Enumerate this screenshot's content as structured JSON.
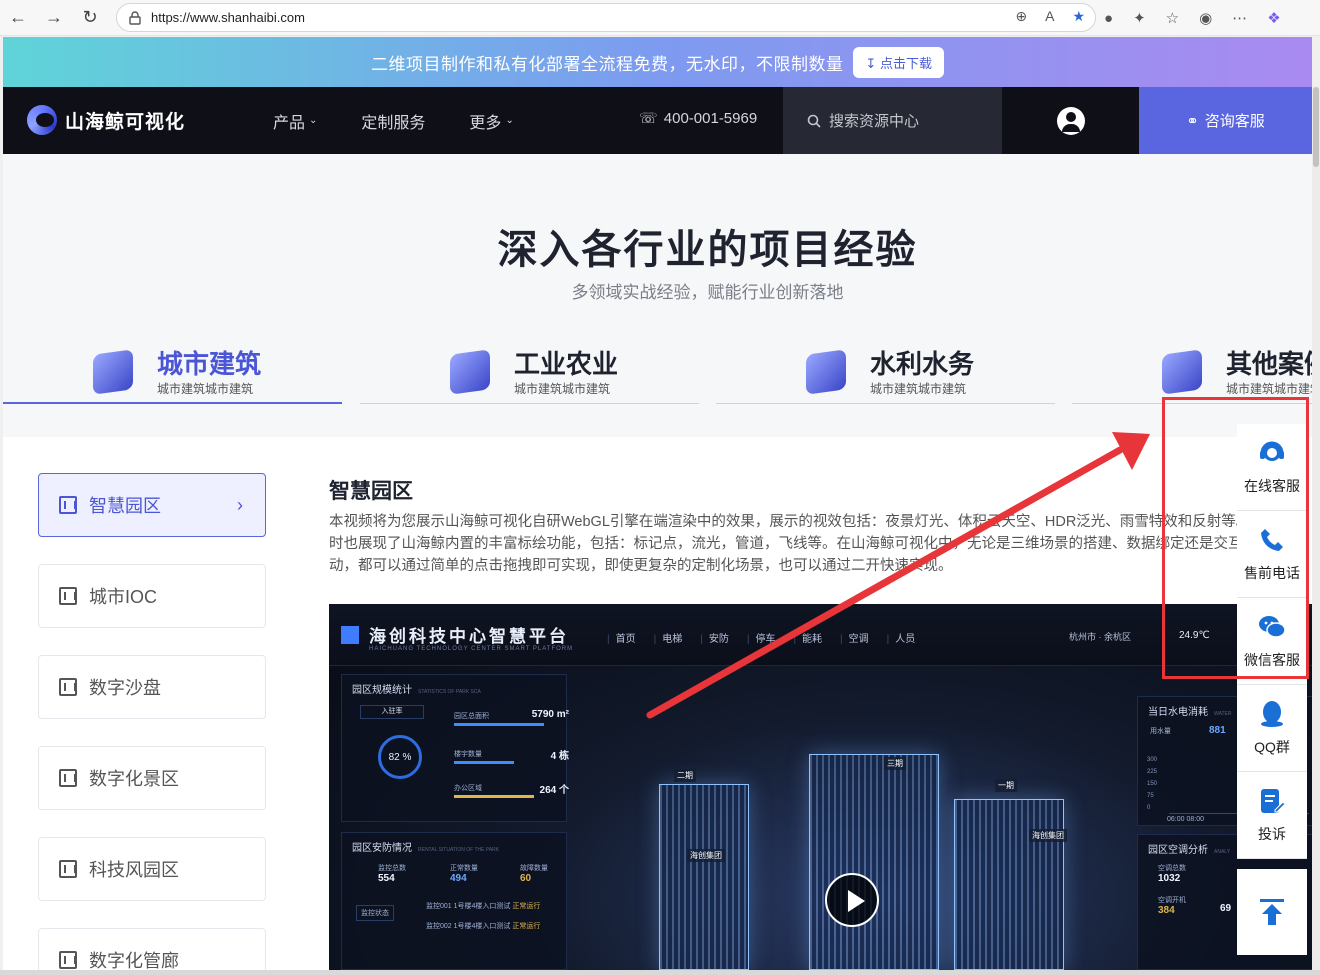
{
  "browser": {
    "url": "https://www.shanhaibi.com",
    "back_icon": "arrow-left-icon",
    "forward_icon": "arrow-right-icon",
    "refresh_icon": "refresh-icon"
  },
  "promo": {
    "text": "二维项目制作和私有化部署全流程免费，无水印，不限制数量",
    "button": "点击下载"
  },
  "nav": {
    "logo_text": "山海鲸可视化",
    "menu": [
      "产品",
      "定制服务",
      "更多"
    ],
    "phone": "400-001-5969",
    "search_placeholder": "搜索资源中心",
    "consult": "咨询客服"
  },
  "section": {
    "title": "深入各行业的项目经验",
    "subtitle": "多领域实战经验，赋能行业创新落地"
  },
  "categories": [
    {
      "name": "城市建筑",
      "desc": "城市建筑城市建筑",
      "active": true
    },
    {
      "name": "工业农业",
      "desc": "城市建筑城市建筑",
      "active": false
    },
    {
      "name": "水利水务",
      "desc": "城市建筑城市建筑",
      "active": false
    },
    {
      "name": "其他案例",
      "desc": "城市建筑城市建筑",
      "active": false
    }
  ],
  "side_items": [
    "智慧园区",
    "城市IOC",
    "数字沙盘",
    "数字化景区",
    "科技风园区",
    "数字化管廊"
  ],
  "article": {
    "title": "智慧园区",
    "body": "本视频将为您展示山海鲸可视化自研WebGL引擎在端渲染中的效果，展示的视效包括：夜景灯光、体积云天空、HDR泛光、雨雪特效和反射等。同时也展现了山海鲸内置的丰富标绘功能，包括：标记点，流光，管道，飞线等。在山海鲸可视化中，无论是三维场景的搭建、数据绑定还是交互联动，都可以通过简单的点击拖拽即可实现，即使更复杂的定制化场景，也可以通过二开快速实现。"
  },
  "video": {
    "title": "海创科技中心智慧平台",
    "subtitle": "HAICHUANG TECHNOLOGY CENTER SMART PLATFORM",
    "nav": [
      "首页",
      "电梯",
      "安防",
      "停车",
      "能耗",
      "空调",
      "人员"
    ],
    "location": "杭州市 · 余杭区",
    "temp": "24.9℃",
    "panel1_title": "园区规模统计",
    "panel1_sub": "STATISTICS OF PARK SCA",
    "dropdown": "入驻率",
    "gauge": "82 %",
    "stats": [
      {
        "label": "园区总面积",
        "value": "5790 m²"
      },
      {
        "label": "楼宇数量",
        "value": "4 栋"
      },
      {
        "label": "办公区域",
        "value": "264 个"
      }
    ],
    "panel2_title": "园区安防情况",
    "panel2_sub": "RENTAL SITUATION OF THE PARK",
    "monitor_total_label": "监控总数",
    "monitor_total": "554",
    "normal_label": "正常数量",
    "normal": "494",
    "fault_label": "故障数量",
    "fault": "60",
    "monitor_status": "监控状态",
    "m1": "监控001",
    "m1_loc": "1号楼4楼入口测试",
    "m1_status": "正常运行",
    "m2": "监控002",
    "m2_loc": "1号楼4楼入口测试",
    "m2_status": "正常运行",
    "panel3_title": "当日水电消耗",
    "panel3_sub": "WATER",
    "water_label": "用水量",
    "water_value": "881",
    "axis": [
      "300",
      "225",
      "150",
      "75",
      "0"
    ],
    "time_range": "06:00 08:00",
    "panel4_title": "园区空调分析",
    "panel4_sub": "ANALY",
    "ac_total_label": "空调总数",
    "ac_total": "1032",
    "ac_on_label": "空调开机",
    "ac_on": "384",
    "ac_right1": "69",
    "building_labels": [
      "二期",
      "三期",
      "海创集团",
      "海创集团",
      "一期"
    ]
  },
  "float_bar": [
    {
      "label": "在线客服",
      "icon": "headset-icon"
    },
    {
      "label": "售前电话",
      "icon": "phone-icon"
    },
    {
      "label": "微信客服",
      "icon": "wechat-icon"
    },
    {
      "label": "QQ群",
      "icon": "qq-icon"
    },
    {
      "label": "投诉",
      "icon": "complaint-icon"
    }
  ],
  "back_to_top_icon": "arrow-up-icon",
  "colors": {
    "accent": "#5a66e0",
    "nav_bg": "#0e0f17",
    "annotation_red": "#e8353a"
  }
}
